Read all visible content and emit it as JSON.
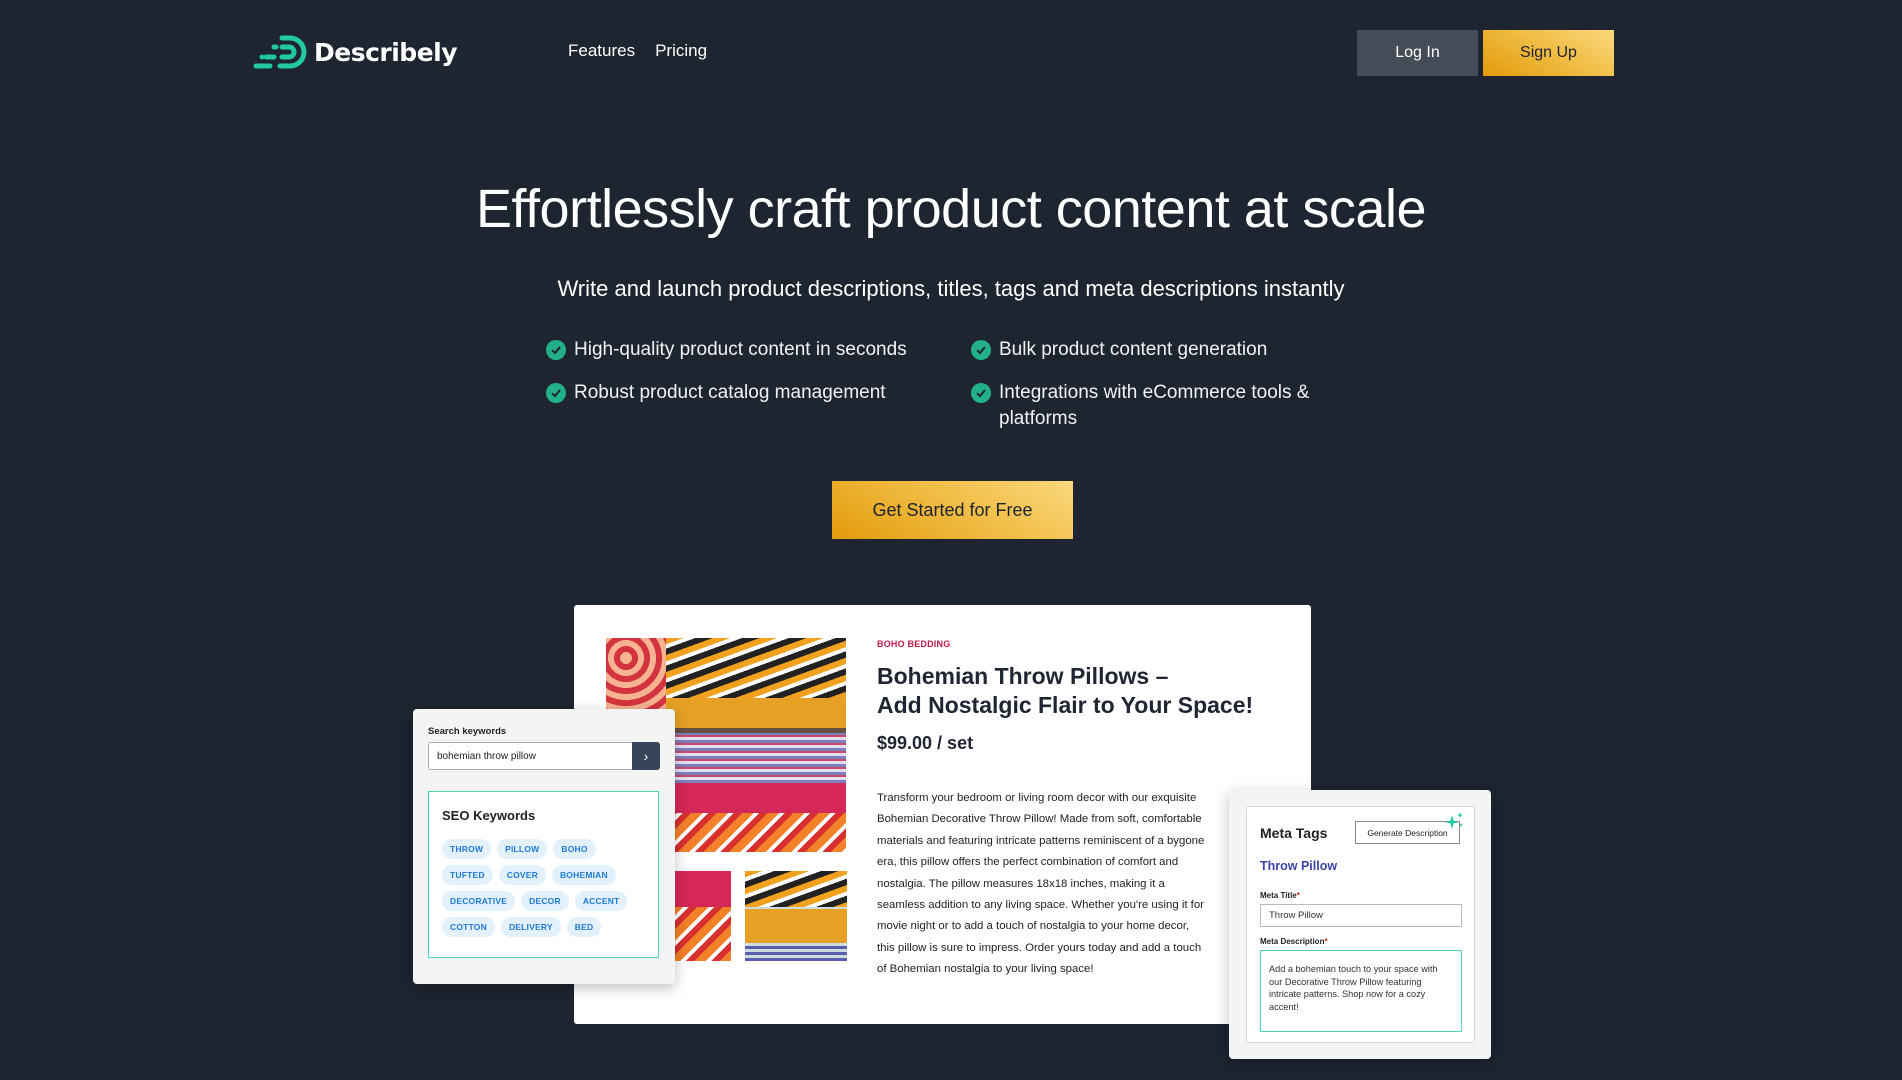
{
  "header": {
    "brand": "Describely",
    "nav": [
      {
        "label": "Features"
      },
      {
        "label": "Pricing"
      }
    ],
    "login_label": "Log In",
    "signup_label": "Sign Up"
  },
  "hero": {
    "title": "Effortlessly craft product content at scale",
    "subtitle": "Write and launch product descriptions, titles, tags and meta descriptions instantly",
    "features": [
      "High-quality product content in seconds",
      "Bulk product content generation",
      "Robust product catalog management",
      "Integrations with eCommerce tools & platforms"
    ],
    "cta_label": "Get Started for Free"
  },
  "product": {
    "category": "BOHO BEDDING",
    "title": "Bohemian Throw Pillows – Add Nostalgic Flair to Your Space!",
    "price": "$99.00 / set",
    "description": "Transform your bedroom or living room decor with our exquisite Bohemian Decorative Throw Pillow! Made from soft, comfortable materials and featuring intricate patterns reminiscent of a bygone era, this pillow offers the perfect combination of comfort and nostalgia. The pillow measures 18x18 inches, making it a seamless addition to any living space. Whether you're using it for movie night or to add a touch of nostalgia to your home decor, this pillow is sure to impress. Order yours today and add a touch of Bohemian nostalgia to your living space!"
  },
  "keywords_panel": {
    "search_label": "Search keywords",
    "search_value": "bohemian throw pillow",
    "seo_title": "SEO Keywords",
    "chips": [
      "THROW",
      "PILLOW",
      "BOHO",
      "TUFTED",
      "COVER",
      "BOHEMIAN",
      "DECORATIVE",
      "DECOR",
      "ACCENT",
      "COTTON",
      "DELIVERY",
      "BED"
    ]
  },
  "meta_panel": {
    "title": "Meta Tags",
    "generate_label": "Generate Description",
    "product_name": "Throw Pillow",
    "meta_title_label": "Meta Title",
    "meta_title_value": "Throw Pillow",
    "meta_description_label": "Meta Description",
    "meta_description_value": "Add a bohemian touch to your space with our Decorative Throw Pillow featuring intricate patterns. Shop now for a cozy accent!",
    "required_marker": "*"
  },
  "colors": {
    "background": "#1e2430",
    "accent_teal": "#21b08a",
    "accent_gold": "#f2c14d",
    "category_red": "#c2194a",
    "meta_blue": "#3b44a8"
  }
}
